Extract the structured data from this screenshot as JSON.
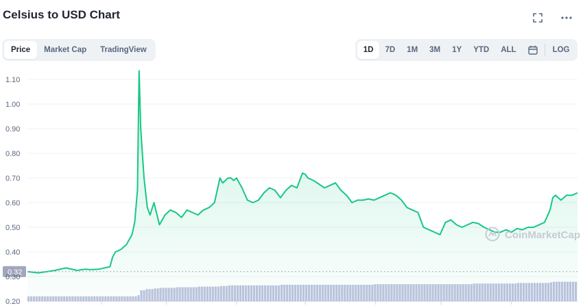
{
  "header": {
    "title": "Celsius to USD Chart"
  },
  "tabs_left": [
    {
      "label": "Price",
      "active": true
    },
    {
      "label": "Market Cap",
      "active": false
    },
    {
      "label": "TradingView",
      "active": false
    }
  ],
  "tabs_right": [
    {
      "label": "1D",
      "active": true
    },
    {
      "label": "7D",
      "active": false
    },
    {
      "label": "1M",
      "active": false
    },
    {
      "label": "3M",
      "active": false
    },
    {
      "label": "1Y",
      "active": false
    },
    {
      "label": "YTD",
      "active": false
    },
    {
      "label": "ALL",
      "active": false
    }
  ],
  "log_label": "LOG",
  "icons": {
    "fullscreen": "fullscreen-icon",
    "more": "more-icon",
    "calendar": "calendar-icon"
  },
  "colors": {
    "line": "#16c784",
    "fill_top": "#16c784",
    "volume": "#b3b8d9",
    "current_bg": "#a1a7bb"
  },
  "watermark": "CoinMarketCap",
  "chart_data": {
    "type": "area",
    "ylim": [
      0.2,
      1.15
    ],
    "yticks": [
      0.2,
      0.3,
      0.4,
      0.5,
      0.6,
      0.7,
      0.8,
      0.9,
      1.0,
      1.1
    ],
    "ytick_labels": [
      "0.20",
      "0.30",
      "0.40",
      "0.50",
      "0.60",
      "0.70",
      "0.80",
      "0.90",
      "1.00",
      "1.10"
    ],
    "current_value_label": "0.32",
    "current_value": 0.32,
    "grid": true,
    "x": [
      0,
      0.02,
      0.05,
      0.07,
      0.09,
      0.105,
      0.115,
      0.13,
      0.15,
      0.155,
      0.16,
      0.17,
      0.18,
      0.185,
      0.19,
      0.195,
      0.2,
      0.203,
      0.206,
      0.212,
      0.218,
      0.223,
      0.23,
      0.24,
      0.25,
      0.26,
      0.27,
      0.28,
      0.29,
      0.3,
      0.31,
      0.32,
      0.33,
      0.34,
      0.35,
      0.355,
      0.36,
      0.365,
      0.37,
      0.375,
      0.38,
      0.385,
      0.39,
      0.4,
      0.41,
      0.42,
      0.43,
      0.44,
      0.45,
      0.46,
      0.47,
      0.48,
      0.49,
      0.5,
      0.505,
      0.51,
      0.52,
      0.53,
      0.54,
      0.55,
      0.56,
      0.57,
      0.58,
      0.59,
      0.6,
      0.61,
      0.62,
      0.63,
      0.64,
      0.65,
      0.66,
      0.67,
      0.68,
      0.69,
      0.7,
      0.71,
      0.72,
      0.73,
      0.74,
      0.75,
      0.76,
      0.77,
      0.78,
      0.79,
      0.8,
      0.81,
      0.82,
      0.83,
      0.84,
      0.85,
      0.86,
      0.87,
      0.88,
      0.89,
      0.9,
      0.91,
      0.92,
      0.93,
      0.94,
      0.95,
      0.955,
      0.96,
      0.97,
      0.98,
      0.99,
      1.0
    ],
    "values": [
      0.32,
      0.315,
      0.325,
      0.335,
      0.325,
      0.33,
      0.328,
      0.33,
      0.34,
      0.38,
      0.4,
      0.41,
      0.43,
      0.45,
      0.47,
      0.52,
      0.65,
      1.135,
      0.9,
      0.7,
      0.58,
      0.55,
      0.6,
      0.51,
      0.55,
      0.57,
      0.56,
      0.54,
      0.57,
      0.56,
      0.55,
      0.57,
      0.58,
      0.6,
      0.7,
      0.68,
      0.69,
      0.7,
      0.7,
      0.69,
      0.7,
      0.68,
      0.66,
      0.61,
      0.6,
      0.61,
      0.64,
      0.66,
      0.65,
      0.62,
      0.65,
      0.67,
      0.66,
      0.72,
      0.715,
      0.7,
      0.69,
      0.675,
      0.66,
      0.67,
      0.68,
      0.65,
      0.63,
      0.6,
      0.61,
      0.61,
      0.615,
      0.61,
      0.62,
      0.63,
      0.64,
      0.63,
      0.61,
      0.58,
      0.57,
      0.56,
      0.5,
      0.49,
      0.48,
      0.47,
      0.52,
      0.53,
      0.51,
      0.5,
      0.51,
      0.52,
      0.515,
      0.5,
      0.49,
      0.48,
      0.48,
      0.49,
      0.48,
      0.495,
      0.49,
      0.5,
      0.5,
      0.51,
      0.52,
      0.57,
      0.62,
      0.63,
      0.61,
      0.63,
      0.63,
      0.64
    ],
    "volume": [
      0.04,
      0.04,
      0.04,
      0.04,
      0.04,
      0.04,
      0.04,
      0.04,
      0.04,
      0.04,
      0.04,
      0.04,
      0.04,
      0.04,
      0.04,
      0.04,
      0.05,
      0.08,
      0.09,
      0.1,
      0.1,
      0.1,
      0.105,
      0.11,
      0.11,
      0.11,
      0.115,
      0.115,
      0.115,
      0.115,
      0.12,
      0.12,
      0.12,
      0.12,
      0.125,
      0.125,
      0.125,
      0.13,
      0.13,
      0.13,
      0.13,
      0.13,
      0.13,
      0.13,
      0.13,
      0.13,
      0.13,
      0.13,
      0.13,
      0.135,
      0.135,
      0.135,
      0.135,
      0.135,
      0.135,
      0.135,
      0.135,
      0.135,
      0.135,
      0.135,
      0.135,
      0.135,
      0.135,
      0.135,
      0.135,
      0.135,
      0.135,
      0.14,
      0.14,
      0.14,
      0.14,
      0.14,
      0.14,
      0.14,
      0.14,
      0.14,
      0.14,
      0.14,
      0.14,
      0.14,
      0.14,
      0.14,
      0.14,
      0.14,
      0.14,
      0.145,
      0.145,
      0.145,
      0.145,
      0.145,
      0.145,
      0.145,
      0.145,
      0.15,
      0.15,
      0.15,
      0.15,
      0.15,
      0.15,
      0.155,
      0.16,
      0.16,
      0.16,
      0.16,
      0.16,
      0.16
    ]
  }
}
